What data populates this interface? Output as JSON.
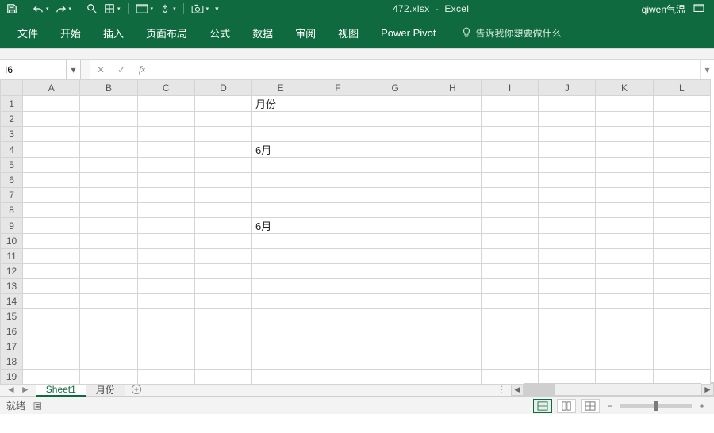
{
  "title": {
    "filename": "472.xlsx",
    "sep": "-",
    "app": "Excel"
  },
  "account": "qiwen气温",
  "qat": {
    "save": "save-icon",
    "undo": "undo-icon",
    "redo": "redo-icon",
    "preview": "print-preview-icon",
    "borders": "borders-icon",
    "window": "new-window-icon",
    "touch": "touch-mode-icon",
    "camera": "camera-icon"
  },
  "tabs": [
    "文件",
    "开始",
    "插入",
    "页面布局",
    "公式",
    "数据",
    "审阅",
    "视图",
    "Power Pivot"
  ],
  "tellme": "告诉我你想要做什么",
  "namebox": "I6",
  "formula": "",
  "columns": [
    "A",
    "B",
    "C",
    "D",
    "E",
    "F",
    "G",
    "H",
    "I",
    "J",
    "K",
    "L"
  ],
  "rows": [
    "1",
    "2",
    "3",
    "4",
    "5",
    "6",
    "7",
    "8",
    "9",
    "10",
    "11",
    "12",
    "13",
    "14",
    "15",
    "16",
    "17",
    "18",
    "19"
  ],
  "cells": {
    "E1": "月份",
    "E4": "6月",
    "E9": "6月"
  },
  "sheet_tabs": {
    "active": "Sheet1",
    "others": [
      "月份"
    ]
  },
  "status": {
    "ready": "就绪",
    "zoom_pct": ""
  }
}
